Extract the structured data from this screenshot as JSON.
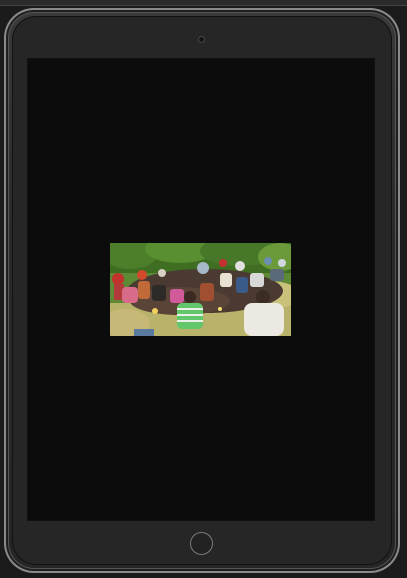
{
  "device": {
    "type": "tablet",
    "orientation": "portrait",
    "frame_color": "#2a2a2a",
    "screen_color": "#0c0c0c"
  },
  "screen": {
    "content": "photo",
    "photo_icon": "photo-of-people-seated-outdoors"
  },
  "controls": {
    "home_button_icon": "home-button-icon",
    "camera_icon": "front-camera-icon"
  }
}
